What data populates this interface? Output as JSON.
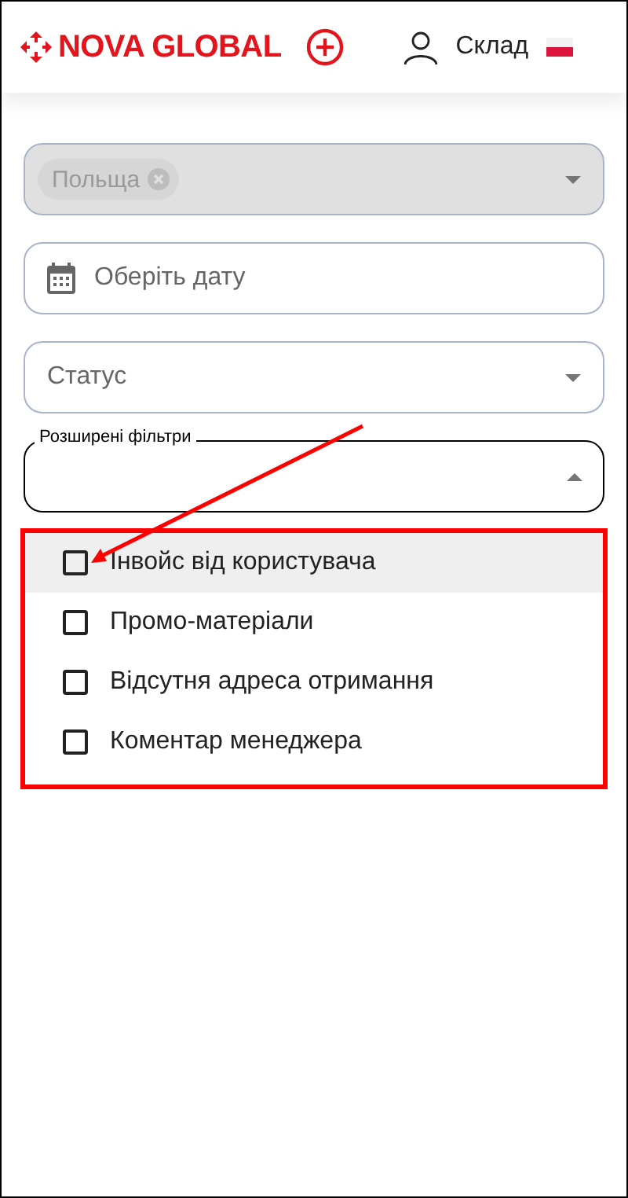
{
  "header": {
    "logo": "NOVA GLOBAL",
    "user_label": "Склад"
  },
  "fields": [
    {
      "kind": "chips",
      "disabled": true,
      "chips": [
        "Польща"
      ]
    },
    {
      "kind": "date",
      "placeholder": "Оберіть дату"
    },
    {
      "kind": "select",
      "placeholder": "Статус"
    },
    {
      "kind": "outlined",
      "label": "Розширені фільтри",
      "expanded": true
    }
  ],
  "menu": {
    "items": [
      {
        "label": "Інвойс від користувача",
        "checked": false,
        "selected": true
      },
      {
        "label": "Промо-матеріали",
        "checked": false,
        "selected": false
      },
      {
        "label": "Відсутня адреса отримання",
        "checked": false,
        "selected": false
      },
      {
        "label": "Коментар менеджера",
        "checked": false,
        "selected": false
      }
    ]
  }
}
